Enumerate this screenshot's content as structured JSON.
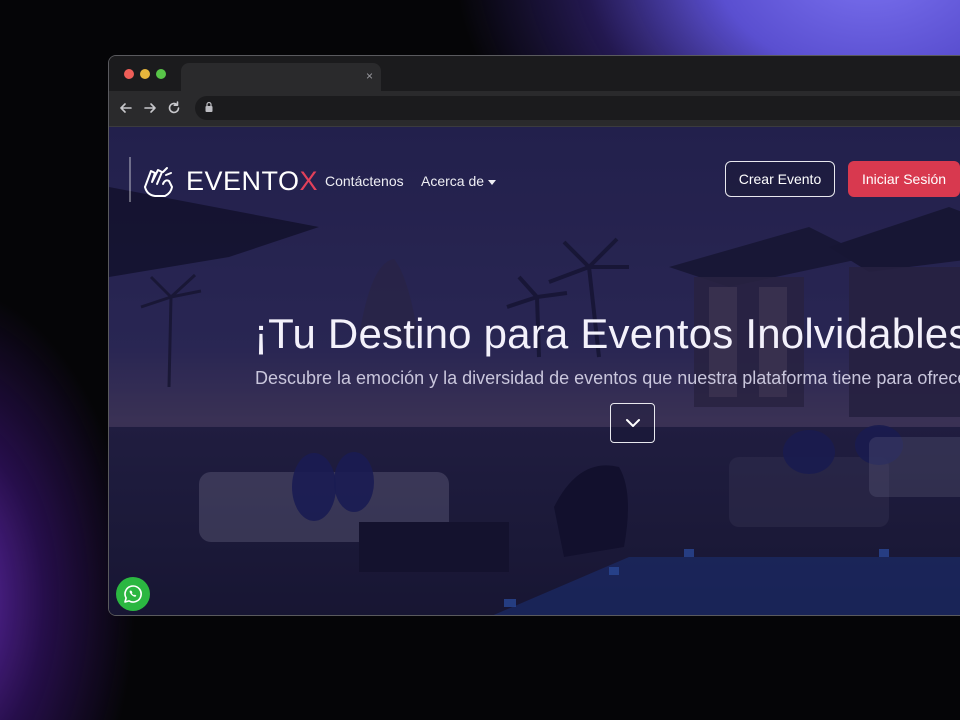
{
  "browser": {
    "tab_close": "×",
    "icons": {
      "back": "arrow-left-icon",
      "forward": "arrow-right-icon",
      "reload": "reload-icon",
      "lock": "lock-icon"
    }
  },
  "site": {
    "brand_main": "EVENTO",
    "brand_accent": "X",
    "nav": {
      "contact": "Contáctenos",
      "about": "Acerca de"
    },
    "buttons": {
      "create_event": "Crear Evento",
      "login": "Iniciar Sesión"
    },
    "hero": {
      "title": "¡Tu Destino para Eventos Inolvidables!",
      "subtitle": "Descubre la emoción y la diversidad de eventos que nuestra plataforma tiene para ofrecerte"
    }
  },
  "colors": {
    "accent": "#d8394f",
    "whatsapp": "#2bb741"
  }
}
